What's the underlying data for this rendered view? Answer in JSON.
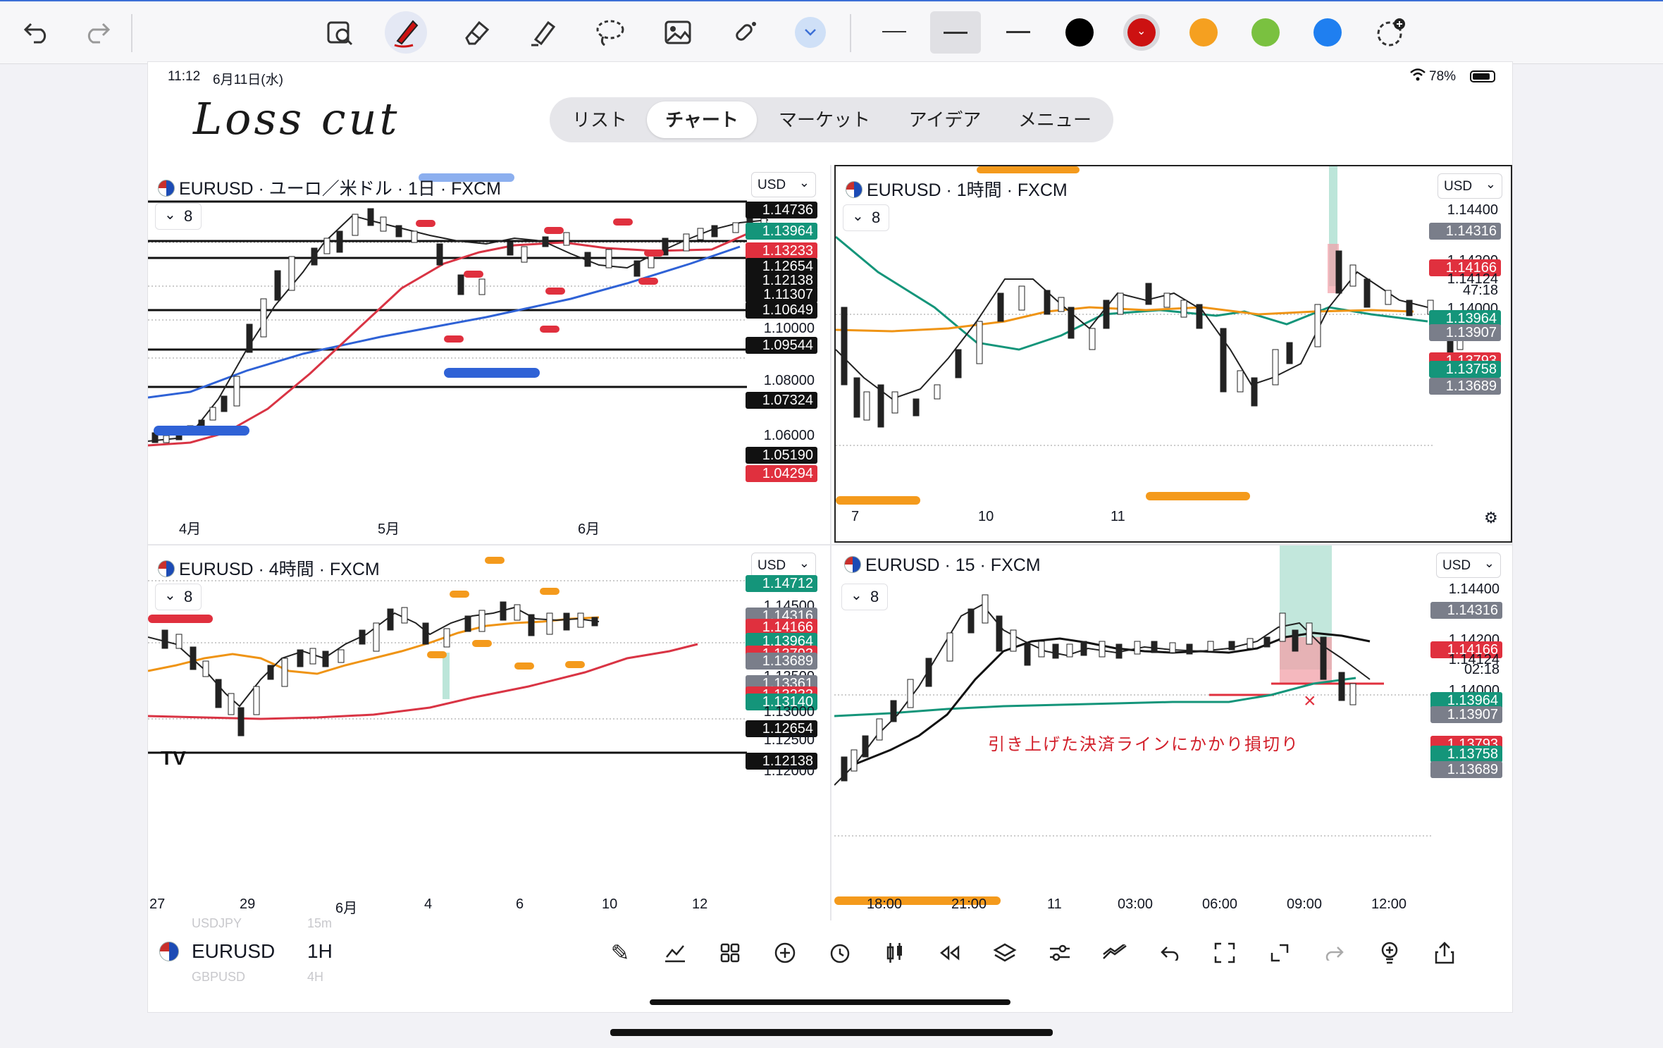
{
  "toolbar": {
    "colors": [
      "#000000",
      "#cc1111",
      "#f5a020",
      "#7ac140",
      "#1f7ff0"
    ],
    "icons": [
      "undo-icon",
      "redo-icon",
      "zoom-image-icon",
      "pen-icon",
      "eraser-icon",
      "highlighter-icon",
      "lasso-icon",
      "image-icon",
      "magic-tape-icon",
      "dropdown-chevron-icon",
      "line-thin-icon",
      "line-medium-icon",
      "line-thick-icon",
      "color-add-icon"
    ]
  },
  "status": {
    "time": "11:12",
    "date": "6月11日(水)",
    "battery": "78%"
  },
  "annotation": {
    "title": "Loss cut",
    "note": "引き上げた決済ラインにかかり損切り",
    "x_mark": "×"
  },
  "tabs": [
    "リスト",
    "チャート",
    "マーケット",
    "アイデア",
    "メニュー"
  ],
  "active_tab": "チャート",
  "panels": [
    {
      "title": "EURUSD · ユーロ／米ドル · 1日 · FXCM",
      "currency": "USD",
      "indicator_count": "8",
      "prices": [
        {
          "text": "1.14736",
          "kind": "black"
        },
        {
          "text": "1.13964",
          "kind": "green"
        },
        {
          "text": "1.13233",
          "kind": "red"
        },
        {
          "text": "1.12654",
          "kind": "black"
        },
        {
          "text": "1.12138",
          "kind": "black"
        },
        {
          "text": "1.11307",
          "kind": "black"
        },
        {
          "text": "1.10649",
          "kind": "black"
        },
        {
          "text": "1.10000",
          "kind": "plain"
        },
        {
          "text": "1.09544",
          "kind": "black"
        },
        {
          "text": "1.08000",
          "kind": "plain"
        },
        {
          "text": "1.07324",
          "kind": "black"
        },
        {
          "text": "1.06000",
          "kind": "plain"
        },
        {
          "text": "1.05190",
          "kind": "black"
        },
        {
          "text": "1.04294",
          "kind": "red"
        }
      ],
      "x_ticks": [
        "4月",
        "5月",
        "6月"
      ]
    },
    {
      "title": "EURUSD · 1時間 · FXCM",
      "currency": "USD",
      "indicator_count": "8",
      "prices": [
        {
          "text": "1.14400",
          "kind": "plain"
        },
        {
          "text": "1.14316",
          "kind": "gray"
        },
        {
          "text": "1.14200",
          "kind": "plain"
        },
        {
          "text": "1.14166",
          "kind": "red"
        },
        {
          "text": "1.14124",
          "kind": "plain"
        },
        {
          "text": "47:18",
          "kind": "plain"
        },
        {
          "text": "1.14000",
          "kind": "plain"
        },
        {
          "text": "1.13964",
          "kind": "green"
        },
        {
          "text": "1.13907",
          "kind": "gray"
        },
        {
          "text": "1.13793",
          "kind": "red"
        },
        {
          "text": "1.13758",
          "kind": "green"
        },
        {
          "text": "1.13689",
          "kind": "gray"
        }
      ],
      "x_ticks": [
        "7",
        "10",
        "11"
      ]
    },
    {
      "title": "EURUSD · 4時間 · FXCM",
      "currency": "USD",
      "indicator_count": "8",
      "prices": [
        {
          "text": "1.14712",
          "kind": "green"
        },
        {
          "text": "1.14500",
          "kind": "plain"
        },
        {
          "text": "1.14316",
          "kind": "gray"
        },
        {
          "text": "1.14166",
          "kind": "red"
        },
        {
          "text": "1.13964",
          "kind": "green"
        },
        {
          "text": "1.13793",
          "kind": "red"
        },
        {
          "text": "1.13689",
          "kind": "gray"
        },
        {
          "text": "1.13500",
          "kind": "plain"
        },
        {
          "text": "1.13361",
          "kind": "gray"
        },
        {
          "text": "1.13233",
          "kind": "red"
        },
        {
          "text": "1.13140",
          "kind": "green"
        },
        {
          "text": "1.13000",
          "kind": "plain"
        },
        {
          "text": "1.12654",
          "kind": "black"
        },
        {
          "text": "1.12500",
          "kind": "plain"
        },
        {
          "text": "1.12138",
          "kind": "black"
        },
        {
          "text": "1.12000",
          "kind": "plain"
        }
      ],
      "x_ticks": [
        "27",
        "29",
        "6月",
        "4",
        "6",
        "10",
        "12"
      ]
    },
    {
      "title": "EURUSD · 15 · FXCM",
      "currency": "USD",
      "indicator_count": "8",
      "prices": [
        {
          "text": "1.14400",
          "kind": "plain"
        },
        {
          "text": "1.14316",
          "kind": "gray"
        },
        {
          "text": "1.14200",
          "kind": "plain"
        },
        {
          "text": "1.14166",
          "kind": "red"
        },
        {
          "text": "1.14124",
          "kind": "plain"
        },
        {
          "text": "02:18",
          "kind": "plain"
        },
        {
          "text": "1.14000",
          "kind": "plain"
        },
        {
          "text": "1.13964",
          "kind": "green"
        },
        {
          "text": "1.13907",
          "kind": "gray"
        },
        {
          "text": "1.13793",
          "kind": "red"
        },
        {
          "text": "1.13758",
          "kind": "green"
        },
        {
          "text": "1.13689",
          "kind": "gray"
        }
      ],
      "x_ticks": [
        "18:00",
        "21:00",
        "11",
        "03:00",
        "06:00",
        "09:00",
        "12:00"
      ]
    }
  ],
  "bottom": {
    "symbol": "EURUSD",
    "interval": "1H",
    "symbol_above": "USDJPY",
    "interval_above": "15m",
    "symbol_below": "GBPUSD",
    "interval_below": "4H",
    "logo_text": "TV"
  }
}
